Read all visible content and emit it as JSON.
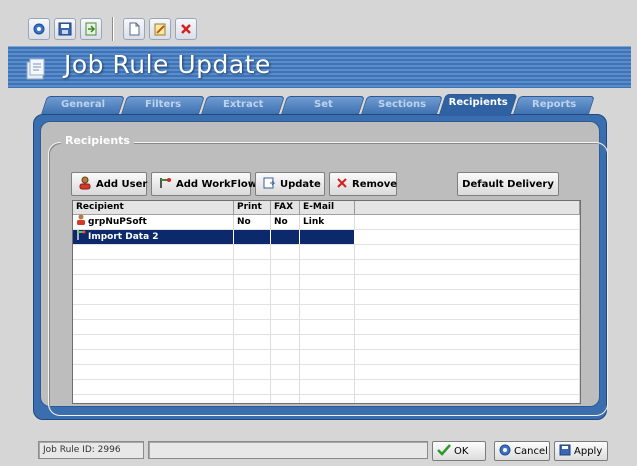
{
  "toolbar": {
    "icons": [
      "refresh-icon",
      "save-icon",
      "export-icon",
      "new-document-icon",
      "edit-icon",
      "delete-icon"
    ]
  },
  "title": "Job Rule Update",
  "tabs": [
    {
      "label": "General",
      "active": false
    },
    {
      "label": "Filters",
      "active": false
    },
    {
      "label": "Extract",
      "active": false
    },
    {
      "label": "Set",
      "active": false
    },
    {
      "label": "Sections",
      "active": false
    },
    {
      "label": "Recipients",
      "active": true
    },
    {
      "label": "Reports",
      "active": false
    }
  ],
  "group_title": "Recipients",
  "buttons": {
    "add_user": "Add User",
    "add_workflow": "Add WorkFlow",
    "update": "Update",
    "remove": "Remove",
    "default_delivery": "Default Delivery"
  },
  "columns": [
    "Recipient",
    "Print",
    "FAX",
    "E-Mail"
  ],
  "rows": [
    {
      "recipient": "grpNuPSoft",
      "print": "No",
      "fax": "No",
      "email": "Link",
      "icon": "user-group-icon",
      "selected": false
    },
    {
      "recipient": "Import Data 2",
      "print": "",
      "fax": "",
      "email": "",
      "icon": "workflow-icon",
      "selected": true
    }
  ],
  "status": {
    "job_rule_id": "Job Rule ID: 2996",
    "ok": "OK",
    "cancel": "Cancel",
    "apply": "Apply"
  },
  "colors": {
    "panel_blue": "#3a6eae",
    "selection": "#0c2a6b",
    "banner": "#4a7fc0"
  }
}
